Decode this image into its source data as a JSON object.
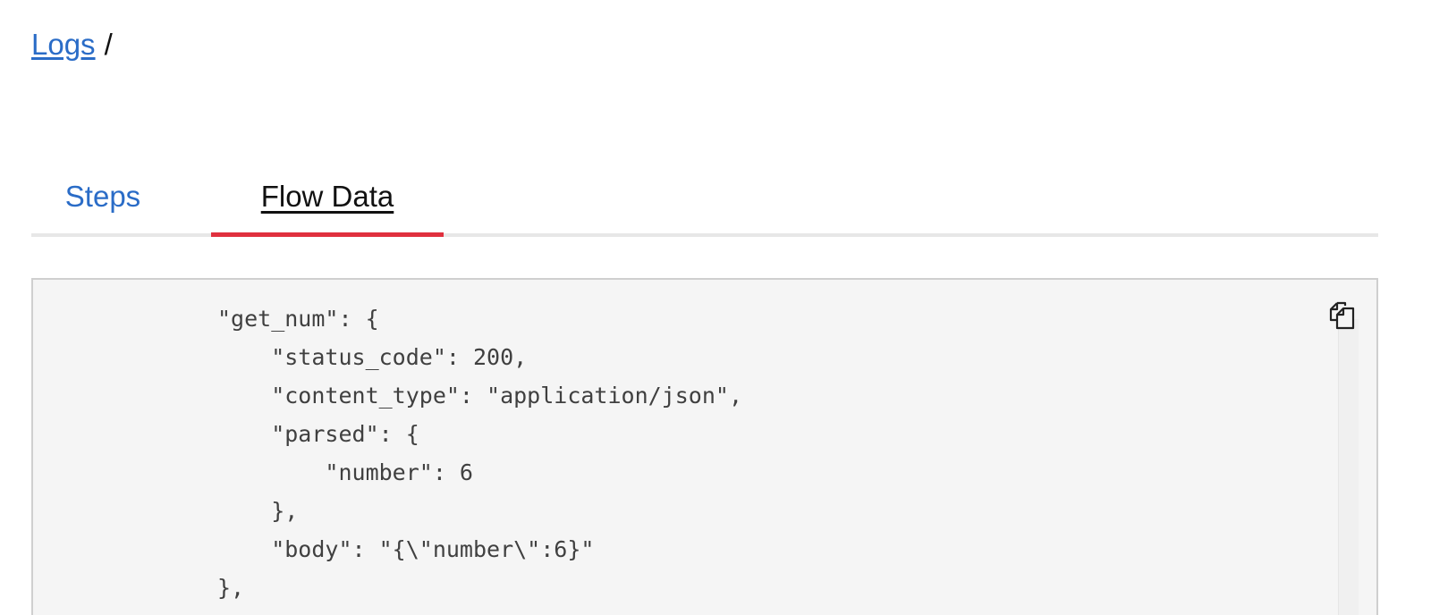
{
  "breadcrumb": {
    "link_label": "Logs",
    "separator": "/"
  },
  "tabs": [
    {
      "label": "Steps",
      "active": false
    },
    {
      "label": "Flow Data",
      "active": true
    }
  ],
  "colors": {
    "link": "#2a6cc7",
    "active_tab_indicator": "#e0303e",
    "code_background": "#f5f5f5"
  },
  "code_panel": {
    "copy_icon": "copy-icon",
    "lines": [
      "\"get_num\": {",
      "    \"status_code\": 200,",
      "    \"content_type\": \"application/json\",",
      "    \"parsed\": {",
      "        \"number\": 6",
      "    },",
      "    \"body\": \"{\\\"number\\\":6}\"",
      "},",
      "              {"
    ]
  }
}
